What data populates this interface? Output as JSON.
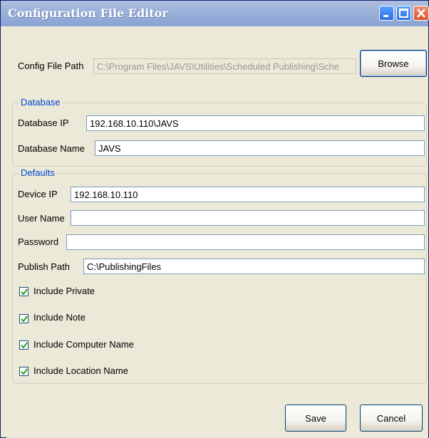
{
  "window": {
    "title": "Configuration File Editor"
  },
  "config": {
    "path_label": "Config File Path",
    "path_value": "C:\\Program Files\\JAVS\\Utilities\\Scheduled Publishing\\Sche",
    "browse_label": "Browse"
  },
  "database": {
    "legend": "Database",
    "ip_label": "Database IP",
    "ip_value": "192.168.10.110\\JAVS",
    "name_label": "Database Name",
    "name_value": "JAVS"
  },
  "defaults": {
    "legend": "Defaults",
    "device_ip_label": "Device IP",
    "device_ip_value": "192.168.10.110",
    "user_name_label": "User Name",
    "user_name_value": "",
    "password_label": "Password",
    "password_value": "",
    "publish_path_label": "Publish Path",
    "publish_path_value": "C:\\PublishingFiles",
    "checkboxes": [
      {
        "label": "Include Private",
        "checked": true
      },
      {
        "label": "Include Note",
        "checked": true
      },
      {
        "label": "Include Computer Name",
        "checked": true
      },
      {
        "label": "Include Location Name",
        "checked": true
      }
    ]
  },
  "footer": {
    "save_label": "Save",
    "cancel_label": "Cancel"
  },
  "colors": {
    "title_bar": "#9cb1da",
    "legend_text": "#0046d5",
    "check_mark": "#21a121"
  },
  "icons": [
    "minimize-icon",
    "maximize-icon",
    "close-icon",
    "checkmark-icon"
  ]
}
